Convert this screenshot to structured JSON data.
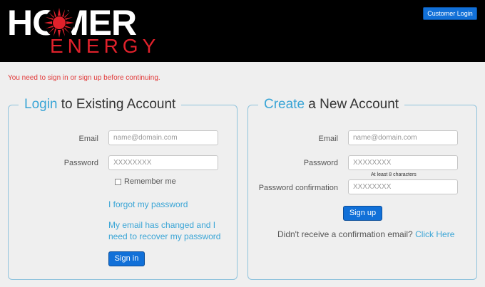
{
  "header": {
    "logo_text": "HOMER",
    "logo_subtext": "ENERGY",
    "customer_login_label": "Customer Login"
  },
  "flash_message": "You need to sign in or sign up before continuing.",
  "login": {
    "title_accent": "Login",
    "title_rest": " to Existing Account",
    "email_label": "Email",
    "email_placeholder": "name@domain.com",
    "password_label": "Password",
    "password_placeholder": "XXXXXXXX",
    "remember_label": "Remember me",
    "forgot_link": "I forgot my password",
    "email_changed_link": "My email has changed and I need to recover my password",
    "sign_in_label": "Sign in"
  },
  "signup": {
    "title_accent": "Create",
    "title_rest": " a New Account",
    "email_label": "Email",
    "email_placeholder": "name@domain.com",
    "password_label": "Password",
    "password_placeholder": "XXXXXXXX",
    "password_hint": "At least 8 characters",
    "confirm_label": "Password confirmation",
    "confirm_placeholder": "XXXXXXXX",
    "sign_up_label": "Sign up",
    "confirmation_question": "Didn't receive a confirmation email?",
    "click_here_label": "Click Here"
  },
  "colors": {
    "accent": "#3aa5d6",
    "button": "#1170d8",
    "brand_red": "#e0212b",
    "flash": "#e23b3b"
  }
}
